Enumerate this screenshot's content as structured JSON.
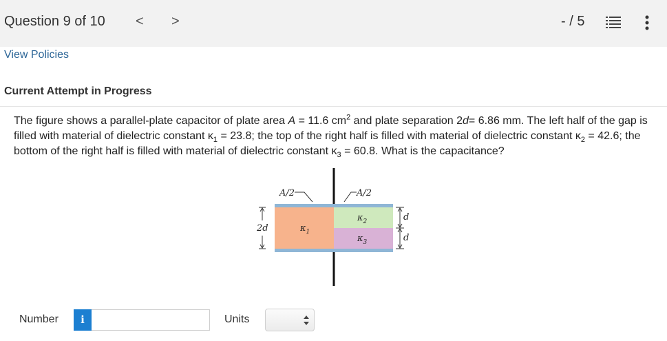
{
  "header": {
    "question_title": "Question 9 of 10",
    "prev_symbol": "<",
    "next_symbol": ">",
    "score": "- / 5"
  },
  "links": {
    "view_policies": "View Policies"
  },
  "attempt_status": "Current Attempt in Progress",
  "question": {
    "p1": "The figure shows a parallel-plate capacitor of plate area ",
    "var_A": "A",
    "p2": " = 11.6 cm",
    "sup2": "2",
    "p3": " and plate separation 2",
    "var_d": "d",
    "p4": "= 6.86 mm. The left half of the gap is filled with material of dielectric constant κ",
    "k1_sub": "1",
    "p5": " = 23.8; the top of the right half is filled with material of dielectric constant κ",
    "k2_sub": "2",
    "p6": " = 42.6; the bottom of the right half is filled with material of dielectric constant κ",
    "k3_sub": "3",
    "p7": " = 60.8. What is the capacitance?"
  },
  "figure": {
    "left_area_label": "A/2",
    "right_area_label": "A/2",
    "gap_label": "2d",
    "kappa": "κ",
    "k1_sub": "1",
    "k2_sub": "2",
    "k3_sub": "3",
    "d_label": "d",
    "colors": {
      "plate": "#8fb6d6",
      "k1": "#f7b38c",
      "k2": "#cfe9bd",
      "k3": "#d9b2d6",
      "wire": "#111111"
    }
  },
  "answer": {
    "number_label": "Number",
    "info_icon_text": "i",
    "number_value": "",
    "units_label": "Units",
    "units_selected": ""
  }
}
